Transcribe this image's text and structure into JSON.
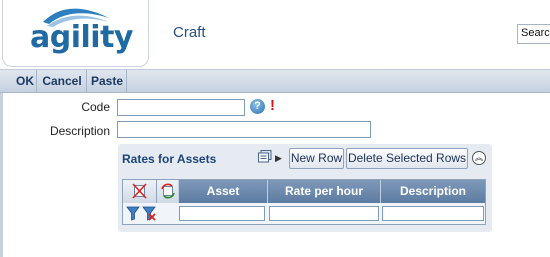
{
  "header": {
    "logo_text": "agility",
    "page_title": "Craft",
    "search_value": "Search"
  },
  "toolbar": {
    "ok_label": "OK",
    "cancel_label": "Cancel",
    "paste_label": "Paste"
  },
  "form": {
    "code_label": "Code",
    "code_value": "",
    "description_label": "Description",
    "description_value": ""
  },
  "rates": {
    "title": "Rates for Assets",
    "new_row_label": "New Row",
    "delete_rows_label": "Delete Selected Rows",
    "columns": [
      "Asset",
      "Rate per hour",
      "Description"
    ],
    "rows": []
  },
  "colors": {
    "accent": "#1f6aa3",
    "toolbar": "#c5d1e0",
    "grid_header": "#6d89ad",
    "required": "#dd1111"
  }
}
